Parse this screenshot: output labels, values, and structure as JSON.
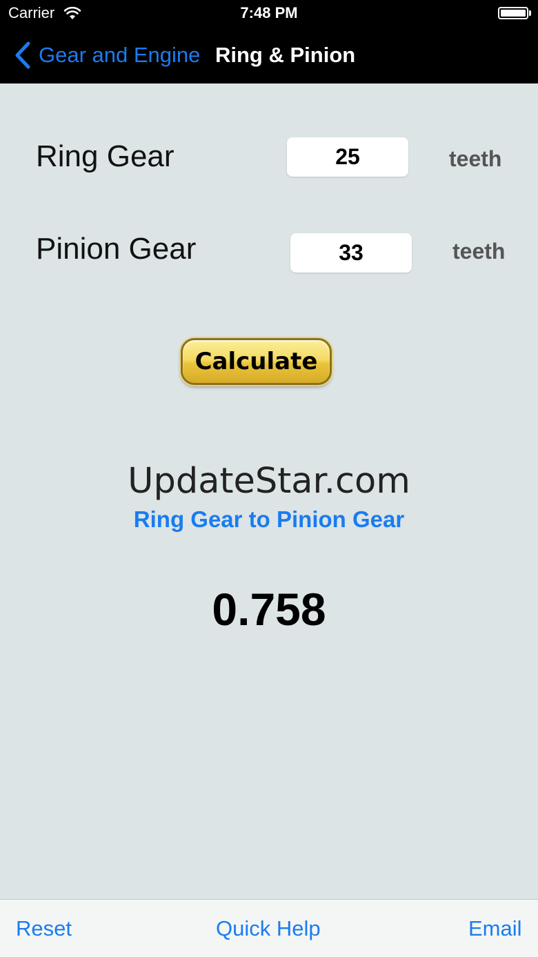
{
  "status_bar": {
    "carrier": "Carrier",
    "time": "7:48 PM",
    "wifi_icon": "wifi-icon",
    "battery_icon": "battery-icon",
    "battery_level": 1.0
  },
  "nav": {
    "back_label": "Gear and Engine",
    "back_icon": "chevron-left-icon",
    "title": "Ring & Pinion"
  },
  "form": {
    "ring": {
      "label": "Ring Gear",
      "value": "25",
      "unit": "teeth"
    },
    "pinion": {
      "label": "Pinion Gear",
      "value": "33",
      "unit": "teeth"
    },
    "calculate_label": "Calculate"
  },
  "result": {
    "brand": "UpdateStar.com",
    "description": "Ring Gear to Pinion Gear",
    "value": "0.758"
  },
  "toolbar": {
    "reset_label": "Reset",
    "help_label": "Quick Help",
    "email_label": "Email"
  },
  "colors": {
    "accent": "#1a7cf0",
    "background": "#dce4e6",
    "bar": "#000000",
    "button_gold": "#f4da63"
  }
}
